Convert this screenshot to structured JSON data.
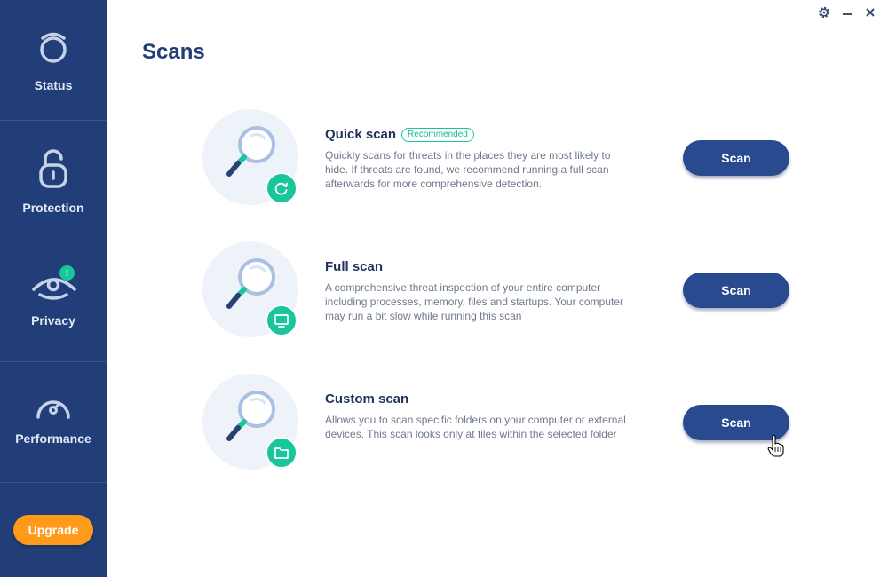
{
  "sidebar": {
    "items": [
      {
        "label": "Status",
        "icon": "status-icon"
      },
      {
        "label": "Protection",
        "icon": "lock-icon"
      },
      {
        "label": "Privacy",
        "icon": "eye-icon",
        "alert": "!"
      },
      {
        "label": "Performance",
        "icon": "speedometer-icon"
      }
    ],
    "upgrade_label": "Upgrade"
  },
  "window": {
    "icons": [
      "gear-icon",
      "minimize-icon",
      "close-icon"
    ]
  },
  "page": {
    "title": "Scans"
  },
  "scans": [
    {
      "name": "Quick scan",
      "badge": "Recommended",
      "description": "Quickly scans for threats in the places they are most likely to hide. If threats are found, we recommend running a full scan afterwards for more comprehensive detection.",
      "button": "Scan",
      "icon": "refresh-icon"
    },
    {
      "name": "Full scan",
      "description": "A comprehensive threat inspection of your entire computer including processes, memory, files and startups. Your computer may run a bit slow while running this scan",
      "button": "Scan",
      "icon": "monitor-icon"
    },
    {
      "name": "Custom scan",
      "description": "Allows you to scan specific folders on your computer or external devices. This scan looks only at files within the selected folder",
      "button": "Scan",
      "icon": "folder-icon"
    }
  ],
  "colors": {
    "sidebar": "#213e78",
    "accent": "#19c59b",
    "button": "#2a4a8f",
    "upgrade": "#ff9a1a",
    "title": "#213e78"
  }
}
